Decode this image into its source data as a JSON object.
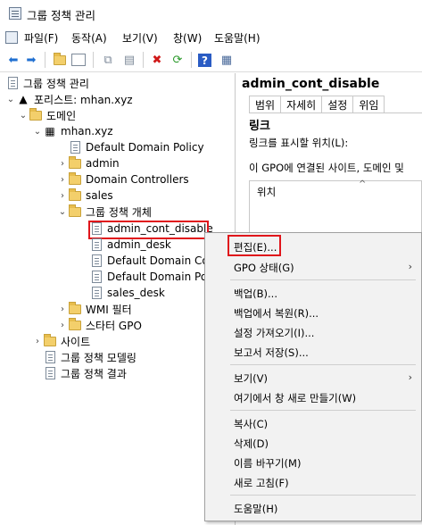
{
  "window": {
    "title": "그룹 정책 관리"
  },
  "menubar": {
    "items": [
      "파일(F)",
      "동작(A)",
      "보기(V)",
      "창(W)",
      "도움말(H)"
    ]
  },
  "toolbar": {
    "icons": [
      "back-arrow-icon",
      "forward-arrow-icon",
      "up-folder-icon",
      "show-hide-tree-icon",
      "copy-icon",
      "paste-icon",
      "delete-icon",
      "refresh-icon",
      "help-icon",
      "properties-icon"
    ]
  },
  "tree": {
    "root": "그룹 정책 관리",
    "forest": "포리스트: mhan.xyz",
    "domains": "도메인",
    "domain": "mhan.xyz",
    "default_policy": "Default Domain Policy",
    "admin": "admin",
    "domain_controllers": "Domain Controllers",
    "sales": "sales",
    "gpo_container": "그룹 정책 개체",
    "gpos": [
      "admin_cont_disable",
      "admin_desk",
      "Default Domain Co",
      "Default Domain Po",
      "sales_desk"
    ],
    "wmi": "WMI 필터",
    "starter": "스타터 GPO",
    "sites": "사이트",
    "modeling": "그룹 정책 모델링",
    "results": "그룹 정책 결과"
  },
  "right_pane": {
    "title": "admin_cont_disable",
    "tabs": [
      "범위",
      "자세히",
      "설정",
      "위임"
    ],
    "section_heading": "링크",
    "link_label": "링크를 표시할 위치(L):",
    "gpo_linked_text": "이 GPO에 연결된 사이트, 도메인 및",
    "column_header": "위치"
  },
  "context_menu": {
    "items": [
      "편집(E)...",
      "GPO 상태(G)",
      "백업(B)...",
      "백업에서 복원(R)...",
      "설정 가져오기(I)...",
      "보고서 저장(S)...",
      "보기(V)",
      "여기에서 창 새로 만들기(W)",
      "복사(C)",
      "삭제(D)",
      "이름 바꾸기(M)",
      "새로 고침(F)",
      "도움말(H)"
    ]
  },
  "colors": {
    "highlight_border": "#e0151b",
    "menu_bg": "#f2f2f2"
  }
}
